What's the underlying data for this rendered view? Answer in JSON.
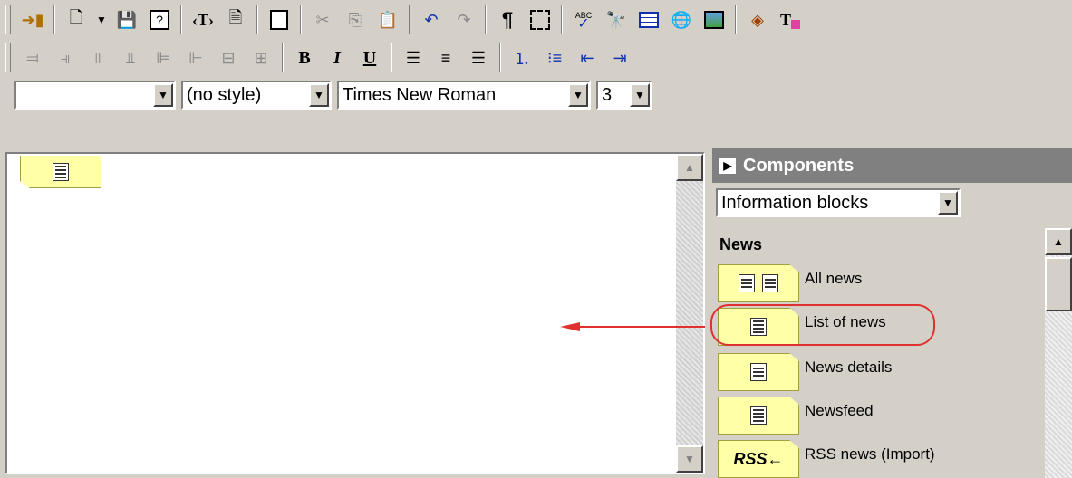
{
  "format_bar": {
    "block_format_value": "",
    "style_value": "(no style)",
    "font_value": "Times New Roman",
    "size_value": "3"
  },
  "components_panel": {
    "title": "Components",
    "category_value": "Information blocks",
    "section_label": "News",
    "items": [
      {
        "label": "All news",
        "icon": "all-news-icon"
      },
      {
        "label": "List of news",
        "icon": "list-of-news-icon"
      },
      {
        "label": "News details",
        "icon": "news-details-icon"
      },
      {
        "label": "Newsfeed",
        "icon": "newsfeed-icon"
      },
      {
        "label": "RSS news (Import)",
        "icon": "rss-import-icon",
        "icon_text": "RSS←"
      }
    ]
  },
  "toolbar": {
    "bold_label": "B",
    "italic_label": "I",
    "underline_label": "U",
    "template_tag_label": "‹T›",
    "paragraph_label": "¶",
    "abc_label": "ABC"
  },
  "colors": {
    "panel_background": "#d4d0c8",
    "component_tag": "#ffffa8",
    "highlight": "#e03030"
  }
}
